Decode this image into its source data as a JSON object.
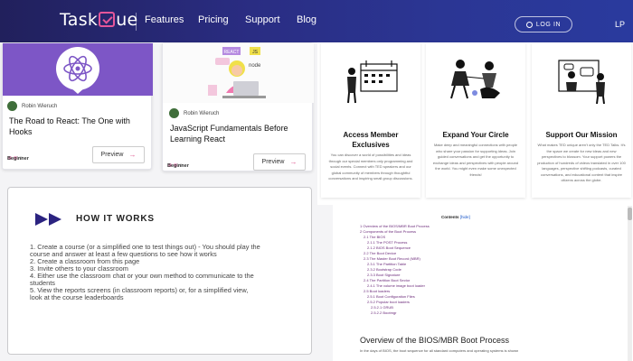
{
  "nav": {
    "logo": {
      "pre": "Task",
      "post": "ue"
    },
    "links": [
      "Features",
      "Pricing",
      "Support",
      "Blog"
    ],
    "login": "LOG IN",
    "extra": "LP"
  },
  "courses": [
    {
      "author": "Robin Wieruch",
      "title": "The Road to React: The One with Hooks",
      "level": "Beginner",
      "preview": "Preview",
      "arrow": "→"
    },
    {
      "author": "Robin Wieruch",
      "title": "JavaScript Fundamentals Before Learning React",
      "level": "Beginner",
      "preview": "Preview",
      "arrow": "→",
      "badges": [
        "REACT",
        "JS",
        "node"
      ]
    }
  ],
  "features": [
    {
      "title": "Access Member Exclusives",
      "text": "You can discover a world of possibilities and ideas through our special members only programming and social events. Connect with TED speakers and our global community of members through thoughtful conversations and inspiring small group discussions."
    },
    {
      "title": "Expand Your Circle",
      "text": "Make deep and meaningful connections with people who share your passion for supporting ideas. Join guided conversations and get the opportunity to exchange ideas and perspectives with people around the world. You might even make some unexpected friends!"
    },
    {
      "title": "Support Our Mission",
      "text": "What makes TED unique aren't only the TED Talks. It's the space we create for new ideas and new perspectives to blossom. Your support powers the production of hundreds of videos translated in over 100 languages, perspective shifting podcasts, curated conversations, and educational content that inspire citizens across the globe."
    }
  ],
  "how": {
    "title": "HOW IT WORKS",
    "steps": [
      "1.  Create a course (or a simplified one to test things out) - You should play the",
      "     course and answer at least a few questions to see how it works",
      "2.  Create a classroom from this page",
      "3.  Invite others to your classroom",
      "4.  Either use the classroom chat or your own method to communicate to the",
      "     students",
      "5.  View the reports screens (in classroom reports) or, for a simplified view,",
      "     look at the course leaderboards"
    ]
  },
  "doc": {
    "contents_label": "Contents",
    "contents_link": "[hide]",
    "toc": [
      "1 Overview of the BIOS/MBR Boot Process",
      "2 Components of the Boot Process",
      "  2.1 The BIOS",
      "    2.1.1 The POST Process",
      "    2.1.2 BIOS Boot Sequence",
      "  2.2 The Boot Device",
      "  2.3 The Master Boot Record (MBR)",
      "    2.3.1 The Partition Table",
      "    2.3.2 Bootstrap Code",
      "    2.3.3 Boot Signature",
      "  2.4 The Partition Boot Sector",
      "    2.4.1 The volume image boot loader",
      "  2.5 Boot loaders",
      "    2.5.1 Boot Configuration Files",
      "    2.5.2 Popular boot loaders",
      "      2.5.2.1 GRUB",
      "      2.5.2.2 Bootmgr"
    ],
    "heading": "Overview of the BIOS/MBR Boot Process",
    "body": "In the days of BIOS, the boot sequence for all standard computers and operating systems is shown"
  }
}
